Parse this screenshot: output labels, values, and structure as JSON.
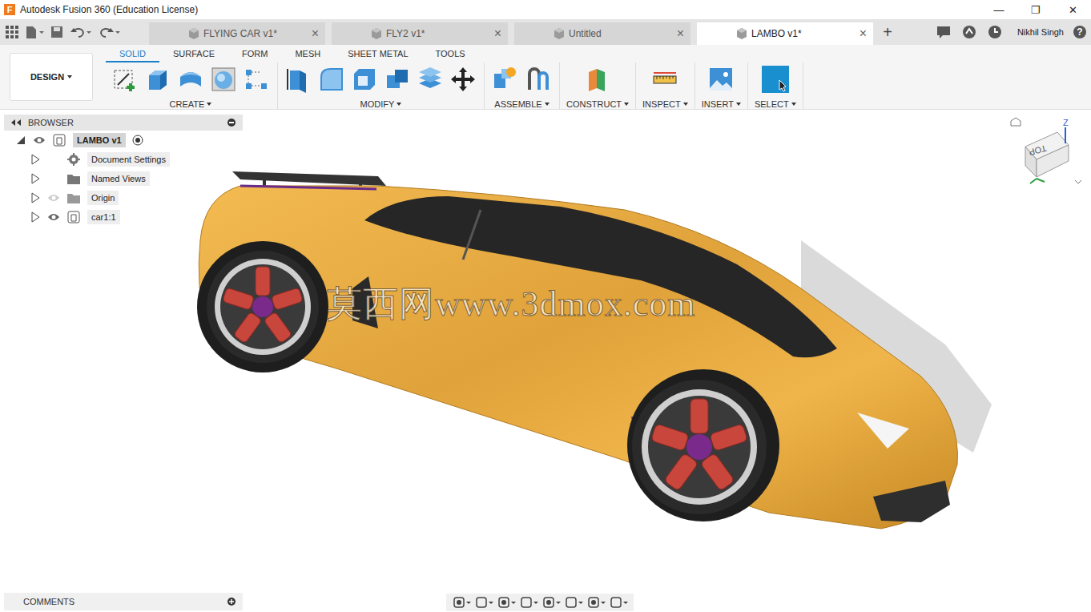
{
  "window": {
    "title": "Autodesk Fusion 360 (Education License)",
    "logo": "F",
    "controls": [
      "—",
      "❐",
      "✕"
    ]
  },
  "tabs": [
    {
      "label": "FLYING CAR v1*",
      "selected": false,
      "close": "×"
    },
    {
      "label": "FLY2 v1*",
      "selected": false,
      "close": "×"
    },
    {
      "label": "Untitled",
      "selected": false,
      "close": "×"
    },
    {
      "label": "LAMBO v1*",
      "selected": true,
      "close": "×"
    }
  ],
  "new_tab": "+",
  "user": "Nikhil Singh",
  "help": "?",
  "workspace": "DESIGN",
  "toolbar_tabs": [
    {
      "label": "SOLID",
      "selected": true
    },
    {
      "label": "SURFACE",
      "selected": false
    },
    {
      "label": "FORM",
      "selected": false
    },
    {
      "label": "MESH",
      "selected": false
    },
    {
      "label": "SHEET METAL",
      "selected": false
    },
    {
      "label": "TOOLS",
      "selected": false
    }
  ],
  "tool_groups": [
    {
      "label": "CREATE",
      "active": false
    },
    {
      "label": "MODIFY",
      "active": false
    },
    {
      "label": "ASSEMBLE",
      "active": false
    },
    {
      "label": "CONSTRUCT",
      "active": false
    },
    {
      "label": "INSPECT",
      "active": false
    },
    {
      "label": "INSERT",
      "active": false
    },
    {
      "label": "SELECT",
      "active": true
    }
  ],
  "browser": {
    "title": "BROWSER",
    "items": [
      {
        "label": "LAMBO v1",
        "kind": "root",
        "expanded": true,
        "has_eye": true,
        "visible": true
      },
      {
        "label": "Document Settings",
        "kind": "settings",
        "expanded": false,
        "has_eye": false,
        "visible": true
      },
      {
        "label": "Named Views",
        "kind": "folder",
        "expanded": false,
        "has_eye": false,
        "visible": true
      },
      {
        "label": "Origin",
        "kind": "folder",
        "expanded": false,
        "has_eye": true,
        "visible": false
      },
      {
        "label": "car1:1",
        "kind": "component",
        "expanded": false,
        "has_eye": true,
        "visible": true
      }
    ]
  },
  "viewcube": {
    "face": "TOP",
    "axis": "Z"
  },
  "watermark": "莫西网www.3dmox.com",
  "comments": {
    "title": "COMMENTS"
  }
}
